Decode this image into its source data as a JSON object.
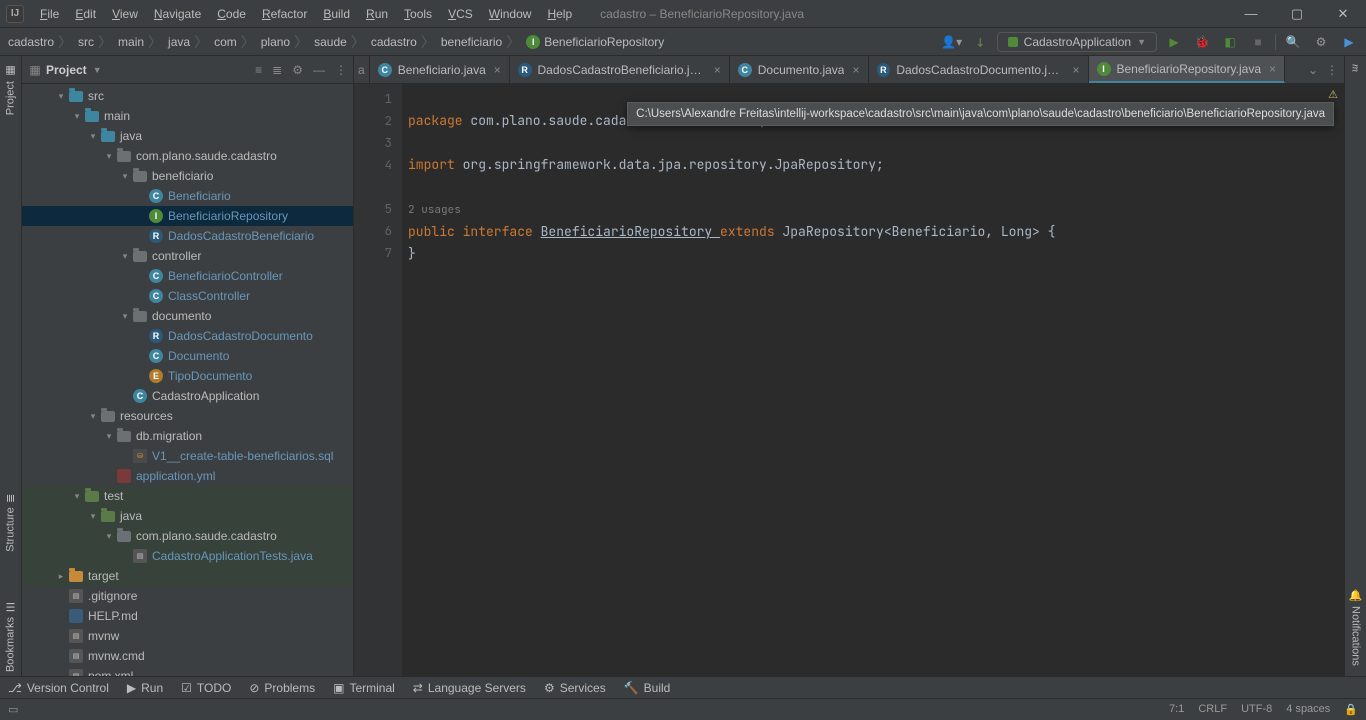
{
  "window": {
    "title": "cadastro – BeneficiarioRepository.java"
  },
  "menu": [
    "File",
    "Edit",
    "View",
    "Navigate",
    "Code",
    "Refactor",
    "Build",
    "Run",
    "Tools",
    "VCS",
    "Window",
    "Help"
  ],
  "breadcrumbs": [
    "cadastro",
    "src",
    "main",
    "java",
    "com",
    "plano",
    "saude",
    "cadastro",
    "beneficiario",
    "BeneficiarioRepository"
  ],
  "run_config": "CadastroApplication",
  "project_pane": {
    "title": "Project"
  },
  "tree": [
    {
      "d": 2,
      "a": "open",
      "icon": "folder-blue",
      "label": "src"
    },
    {
      "d": 3,
      "a": "open",
      "icon": "folder-blue",
      "label": "main"
    },
    {
      "d": 4,
      "a": "open",
      "icon": "folder-blue",
      "label": "java"
    },
    {
      "d": 5,
      "a": "open",
      "icon": "folder",
      "label": "com.plano.saude.cadastro"
    },
    {
      "d": 6,
      "a": "open",
      "icon": "folder",
      "label": "beneficiario"
    },
    {
      "d": 7,
      "a": "none",
      "icon": "ic-c",
      "label": "Beneficiario",
      "git": true
    },
    {
      "d": 7,
      "a": "none",
      "icon": "ic-i",
      "label": "BeneficiarioRepository",
      "git": true,
      "sel": true
    },
    {
      "d": 7,
      "a": "none",
      "icon": "ic-r",
      "label": "DadosCadastroBeneficiario",
      "git": true
    },
    {
      "d": 6,
      "a": "open",
      "icon": "folder",
      "label": "controller"
    },
    {
      "d": 7,
      "a": "none",
      "icon": "ic-c",
      "label": "BeneficiarioController",
      "git": true
    },
    {
      "d": 7,
      "a": "none",
      "icon": "ic-c",
      "label": "ClassController",
      "git": true
    },
    {
      "d": 6,
      "a": "open",
      "icon": "folder",
      "label": "documento"
    },
    {
      "d": 7,
      "a": "none",
      "icon": "ic-r",
      "label": "DadosCadastroDocumento",
      "git": true
    },
    {
      "d": 7,
      "a": "none",
      "icon": "ic-c",
      "label": "Documento",
      "git": true
    },
    {
      "d": 7,
      "a": "none",
      "icon": "ic-e",
      "label": "TipoDocumento",
      "git": true
    },
    {
      "d": 6,
      "a": "none",
      "icon": "ic-c-run",
      "label": "CadastroApplication"
    },
    {
      "d": 4,
      "a": "open",
      "icon": "folder-res",
      "label": "resources"
    },
    {
      "d": 5,
      "a": "open",
      "icon": "folder",
      "label": "db.migration"
    },
    {
      "d": 6,
      "a": "none",
      "icon": "ic-sql",
      "label": "V1__create-table-beneficiarios.sql",
      "git": true
    },
    {
      "d": 5,
      "a": "none",
      "icon": "ic-yml",
      "label": "application.yml",
      "git": true
    },
    {
      "d": 3,
      "a": "open",
      "icon": "folder-green",
      "label": "test",
      "green": true
    },
    {
      "d": 4,
      "a": "open",
      "icon": "folder-green",
      "label": "java",
      "green": true
    },
    {
      "d": 5,
      "a": "open",
      "icon": "folder",
      "label": "com.plano.saude.cadastro",
      "green": true
    },
    {
      "d": 6,
      "a": "none",
      "icon": "ic-file",
      "label": "CadastroApplicationTests.java",
      "git": true,
      "green": true
    },
    {
      "d": 2,
      "a": "closed",
      "icon": "folder-orange",
      "label": "target",
      "green": true
    },
    {
      "d": 2,
      "a": "none",
      "icon": "ic-file",
      "label": ".gitignore"
    },
    {
      "d": 2,
      "a": "none",
      "icon": "ic-md",
      "label": "HELP.md"
    },
    {
      "d": 2,
      "a": "none",
      "icon": "ic-file",
      "label": "mvnw"
    },
    {
      "d": 2,
      "a": "none",
      "icon": "ic-file",
      "label": "mvnw.cmd"
    },
    {
      "d": 2,
      "a": "none",
      "icon": "ic-file",
      "label": "pom.xml"
    }
  ],
  "tabs": [
    {
      "icon": "c",
      "label": "Beneficiario.java"
    },
    {
      "icon": "r",
      "label": "DadosCadastroBeneficiario.java"
    },
    {
      "icon": "c",
      "label": "Documento.java"
    },
    {
      "icon": "r",
      "label": "DadosCadastroDocumento.java"
    },
    {
      "icon": "i",
      "label": "BeneficiarioRepository.java",
      "active": true
    }
  ],
  "editor": {
    "line1_kw": "package",
    "line1_pkg": " com.plano.saude.cadastro.beneficiario;",
    "line3_kw": "import",
    "line3_pkg": " org.springframework.data.jpa.repository.JpaRepository;",
    "usages": "2 usages",
    "line5_a": "public ",
    "line5_b": "interface ",
    "line5_c": "BeneficiarioRepository ",
    "line5_d": "extends ",
    "line5_e": "JpaRepository<Beneficiario, Long> {",
    "line6": "}",
    "tooltip": "C:\\Users\\Alexandre Freitas\\intellij-workspace\\cadastro\\src\\main\\java\\com\\plano\\saude\\cadastro\\beneficiario\\BeneficiarioRepository.java"
  },
  "gutter_lines": [
    "1",
    "2",
    "3",
    "4",
    "",
    "5",
    "6",
    "7"
  ],
  "left_tabs": [
    "Project",
    "Structure",
    "Bookmarks"
  ],
  "right_tabs_top": "m",
  "right_tabs_bottom": "Notifications",
  "bottom_tools": [
    "Version Control",
    "Run",
    "TODO",
    "Problems",
    "Terminal",
    "Language Servers",
    "Services",
    "Build"
  ],
  "status": {
    "pos": "7:1",
    "eol": "CRLF",
    "enc": "UTF-8",
    "indent": "4 spaces"
  }
}
